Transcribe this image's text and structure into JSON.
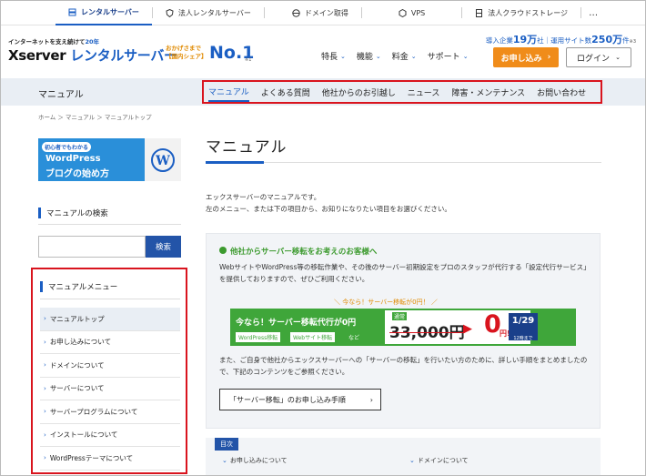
{
  "topbar": {
    "items": [
      {
        "label": "レンタルサーバー",
        "icon": "server-icon"
      },
      {
        "label": "法人レンタルサーバー",
        "icon": "shield-icon"
      },
      {
        "label": "ドメイン取得",
        "icon": "globe-icon"
      },
      {
        "label": "VPS",
        "icon": "cube-icon"
      },
      {
        "label": "法人クラウドストレージ",
        "icon": "storage-icon"
      }
    ],
    "more": "…"
  },
  "header": {
    "tagline_pre": "インターネットを支え続けて",
    "tagline_years": "20年",
    "logo_left": "Xserver",
    "logo_right": "レンタルサーバー",
    "no1_sub1": "おかげさまで",
    "no1_sub2": "【国内シェア】",
    "no1": "No.1",
    "no1_note": "※1",
    "stats_a": "導入企業",
    "stats_a_num": "19万",
    "stats_a_unit": "社",
    "stats_sep": "｜",
    "stats_b": "運用サイト数",
    "stats_b_num": "250万",
    "stats_b_unit": "件",
    "stats_note": "※3",
    "nav": [
      "特長",
      "機能",
      "料金",
      "サポート"
    ],
    "apply": "お申し込み",
    "login": "ログイン"
  },
  "subbar": {
    "title": "マニュアル",
    "items": [
      "マニュアル",
      "よくある質問",
      "他社からのお引越し",
      "ニュース",
      "障害・メンテナンス",
      "お問い合わせ"
    ]
  },
  "breadcrumb": "ホーム ＞ マニュアル ＞ マニュアルトップ",
  "sidebar": {
    "banner_tag": "初心者でもわかる",
    "banner_l1": "WordPress",
    "banner_l2": "ブログの始め方",
    "search_head": "マニュアルの検索",
    "search_btn": "検索",
    "menu_head": "マニュアルメニュー",
    "menu": [
      "マニュアルトップ",
      "お申し込みについて",
      "ドメインについて",
      "サーバーについて",
      "サーバープログラムについて",
      "インストールについて",
      "WordPressテーマについて"
    ]
  },
  "main": {
    "title": "マニュアル",
    "intro1": "エックスサーバーのマニュアルです。",
    "intro2": "左のメニュー、または下の項目から、お知りになりたい項目をお選びください。",
    "card_title": "他社からサーバー移転をお考えのお客様へ",
    "card_p1": "WebサイトやWordPress等の移転作業や、その後のサーバー初期設定をプロのスタッフが代行する「設定代行サービス」を提供しておりますので、ぜひご利用ください。",
    "promo_label": "＼ 今なら！サーバー移転が0円！ ／",
    "promo_t1": "今なら！サーバー移転代行が0円",
    "promo_t2": "WordPress移転",
    "promo_t3": "Webサイト移転",
    "promo_t4": "など",
    "promo_usual": "通常",
    "promo_old": "33,000円",
    "promo_zero": "0",
    "promo_zen": "円!",
    "promo_date": "1/29",
    "promo_date_sub": "12時まで",
    "card_p2": "また、ご自身で他社からエックスサーバーへの「サーバーの移転」を行いたい方のために、詳しい手順をまとめましたので、下記のコンテンツをご参照ください。",
    "card_btn": "「サーバー移転」のお申し込み手順",
    "toc_label": "目次",
    "toc_1": "お申し込みについて",
    "toc_2": "ドメインについて"
  },
  "colors": {
    "accent": "#1a5ec3",
    "highlight": "#d9141e",
    "apply": "#f08c1a",
    "promo": "#3fa63a"
  }
}
